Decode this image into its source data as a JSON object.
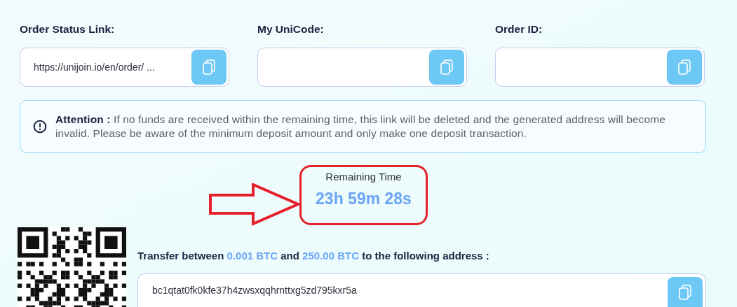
{
  "fields": [
    {
      "label": "Order Status Link:",
      "value": "https://unijoin.io/en/order/  ..."
    },
    {
      "label": "My UniCode:"
    },
    {
      "label": "Order ID:"
    }
  ],
  "attention": "**Attention :** If no funds are received within the remaining time, this link will be deleted and the generated address will become invalid. Please be aware of the minimum deposit amount and only make one deposit transaction.",
  "timer": {
    "label": "Remaining Time",
    "value": "23h 59m 28s"
  },
  "transfer": {
    "parts": [
      {
        "text": "Transfer between ",
        "highlight": false
      },
      {
        "text": "0.001 BTC",
        "highlight": true
      },
      {
        "text": " and ",
        "highlight": false
      },
      {
        "text": "250.00 BTC",
        "highlight": true
      },
      {
        "text": " to the following address :",
        "highlight": false
      }
    ],
    "address": "bc1qtat0fk0kfe37h4zwsxqqhrnttxg5zd795kxr5a"
  }
}
